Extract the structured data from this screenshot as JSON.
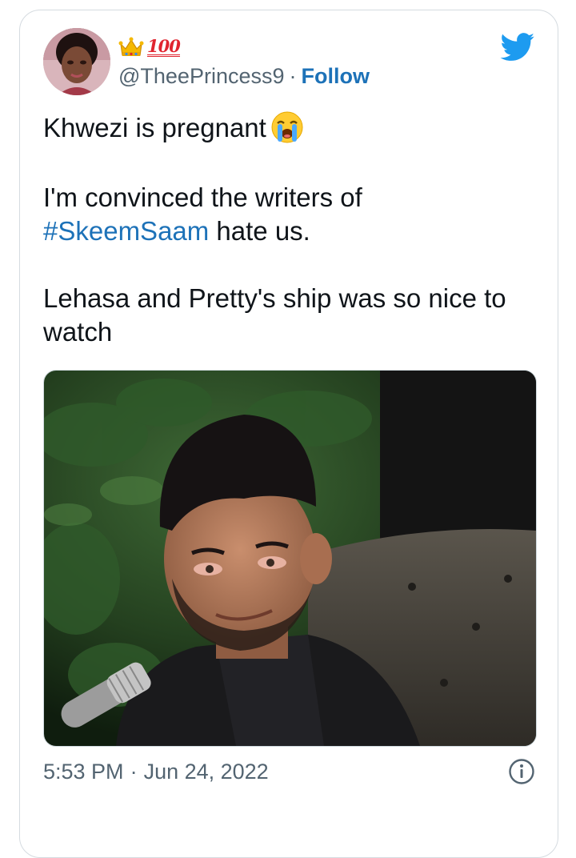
{
  "tweet": {
    "handle": "@TheePrincess9",
    "separator": "·",
    "follow_label": "Follow",
    "badges": [
      "crown-icon",
      "hundred-points-icon"
    ],
    "badge_text": "100",
    "text": {
      "line1": "Khwezi is pregnant",
      "line2_prefix": "I'm convinced the writers of",
      "hashtag": "#SkeemSaam",
      "line3_suffix": " hate us.",
      "line4": "Lehasa and Pretty's ship was so nice to watch",
      "emoji": "loudly-crying-face-icon"
    },
    "time": "5:53 PM",
    "date": "Jun 24, 2022"
  },
  "colors": {
    "link": "#1d72b8",
    "twitter_blue": "#1d9bf0",
    "text": "#0f1419",
    "muted": "#536471",
    "border": "#d5dbe0"
  }
}
